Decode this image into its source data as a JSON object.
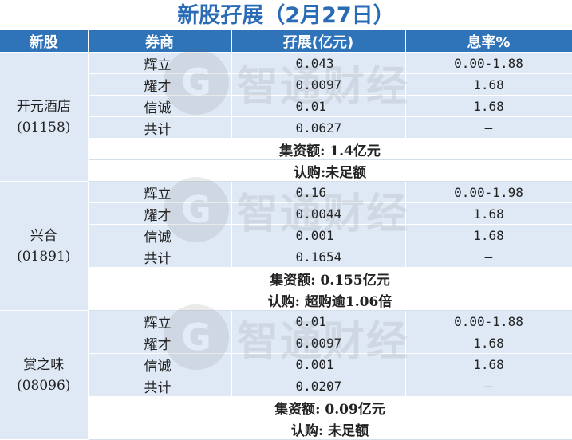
{
  "title": "新股孖展（2月27日）",
  "headers": [
    "新股",
    "券商",
    "孖展(亿元)",
    "息率%"
  ],
  "stocks": [
    {
      "name": "开元酒店",
      "code": "(01158)",
      "rows": [
        {
          "broker": "辉立",
          "amount": "0.043",
          "rate": "0.00-1.88"
        },
        {
          "broker": "耀才",
          "amount": "0.0097",
          "rate": "1.68"
        },
        {
          "broker": "信诚",
          "amount": "0.01",
          "rate": "1.68"
        },
        {
          "broker": "共计",
          "amount": "0.0627",
          "rate": "—"
        }
      ],
      "raised": "集资额: 1.4亿元",
      "subscription": "认购:未足额"
    },
    {
      "name": "兴合",
      "code": "(01891)",
      "rows": [
        {
          "broker": "辉立",
          "amount": "0.16",
          "rate": "0.00-1.98"
        },
        {
          "broker": "耀才",
          "amount": "0.0044",
          "rate": "1.68"
        },
        {
          "broker": "信诚",
          "amount": "0.001",
          "rate": "1.68"
        },
        {
          "broker": "共计",
          "amount": "0.1654",
          "rate": "—"
        }
      ],
      "raised": "集资额: 0.155亿元",
      "subscription": "认购: 超购逾1.06倍"
    },
    {
      "name": "赏之味",
      "code": "(08096)",
      "rows": [
        {
          "broker": "辉立",
          "amount": "0.01",
          "rate": "0.00-1.88"
        },
        {
          "broker": "耀才",
          "amount": "0.0097",
          "rate": "1.68"
        },
        {
          "broker": "信诚",
          "amount": "0.001",
          "rate": "1.68"
        },
        {
          "broker": "共计",
          "amount": "0.0207",
          "rate": "—"
        }
      ],
      "raised": "集资额: 0.09亿元",
      "subscription": "认购: 未足额"
    }
  ],
  "watermark": {
    "logo": "G",
    "text": "智通财经"
  }
}
